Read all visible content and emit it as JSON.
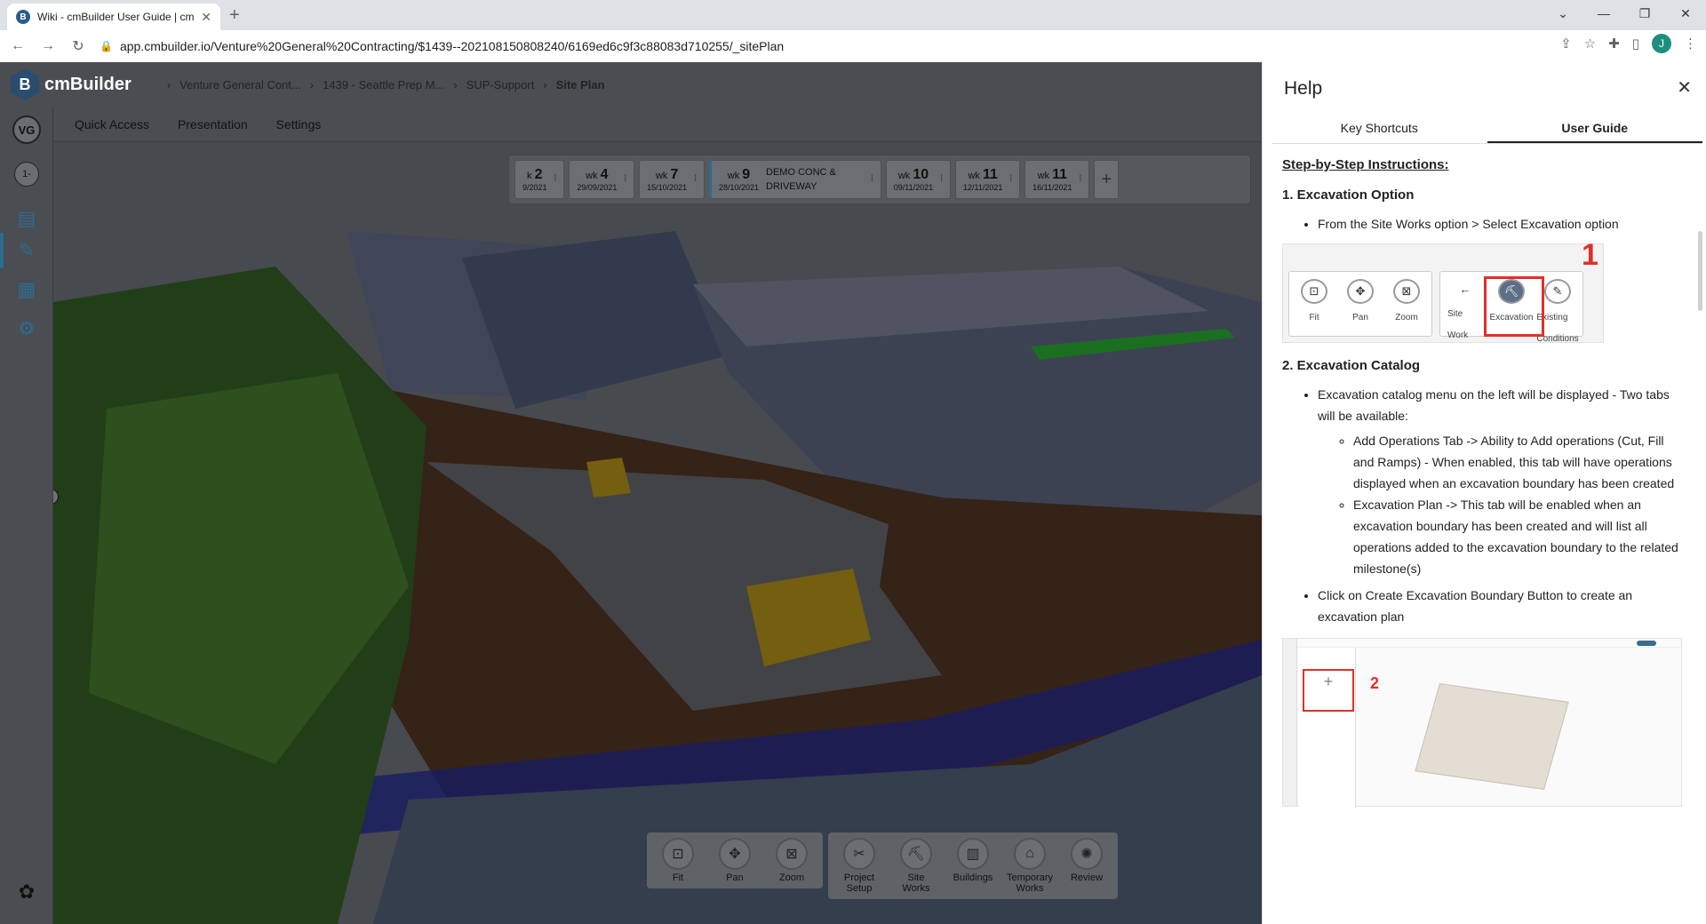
{
  "browser": {
    "tab_title": "Wiki - cmBuilder User Guide | cm",
    "favicon_letter": "B",
    "url": "app.cmbuilder.io/Venture%20General%20Contracting/$1439--202108150808240/6169ed6c9f3c88083d710255/_sitePlan",
    "profile_letter": "J"
  },
  "app": {
    "logo_letter": "B",
    "name": "cmBuilder",
    "breadcrumbs": [
      "Venture General Cont...",
      "1439 - Seattle Prep M...",
      "SUP-Support",
      "Site Plan"
    ],
    "menu": [
      "Quick Access",
      "Presentation",
      "Settings"
    ],
    "org_initials": "VG",
    "phase_badge": "1-"
  },
  "timeline": [
    {
      "prefix": "k",
      "num": "2",
      "date": "9/2021"
    },
    {
      "prefix": "wk",
      "num": "4",
      "date": "29/09/2021"
    },
    {
      "prefix": "wk",
      "num": "7",
      "date": "15/10/2021"
    },
    {
      "prefix": "wk",
      "num": "9",
      "date": "28/10/2021",
      "milestone": "DEMO CONC & DRIVEWAY"
    },
    {
      "prefix": "wk",
      "num": "10",
      "date": "09/11/2021"
    },
    {
      "prefix": "wk",
      "num": "11",
      "date": "12/11/2021"
    },
    {
      "prefix": "wk",
      "num": "11",
      "date": "16/11/2021"
    }
  ],
  "view_controls": {
    "fit": "Fit",
    "pan": "Pan",
    "zoom": "Zoom"
  },
  "tools": {
    "project_setup": "Project Setup",
    "site_works": "Site Works",
    "buildings": "Buildings",
    "temporary_works": "Temporary Works",
    "review": "Review"
  },
  "help": {
    "title": "Help",
    "tabs": [
      "Key Shortcuts",
      "User Guide"
    ],
    "active_tab": "User Guide",
    "heading": "Step-by-Step Instructions:",
    "s1_title": "1. Excavation Option",
    "s1_bullet": "From the Site Works option > Select Excavation option",
    "img1": {
      "number": "1",
      "fit": "Fit",
      "pan": "Pan",
      "zoom": "Zoom",
      "site_work": "Site Work",
      "excavation": "Excavation",
      "existing": "Existing Conditions"
    },
    "s2_title": "2. Excavation Catalog",
    "s2_bullet": "Excavation catalog menu on the left will be displayed - Two tabs will be available:",
    "s2_sub1": "Add Operations Tab -> Ability to Add operations (Cut, Fill and Ramps) -  When enabled, this tab will have operations displayed when an excavation boundary has been created",
    "s2_sub2": "Excavation Plan ->  This tab will be enabled when an excavation boundary has been created and will list all operations added to the excavation boundary to the related milestone(s)",
    "s2_bullet2": "Click on Create Excavation Boundary Button to create an excavation plan",
    "img2_number": "2"
  }
}
